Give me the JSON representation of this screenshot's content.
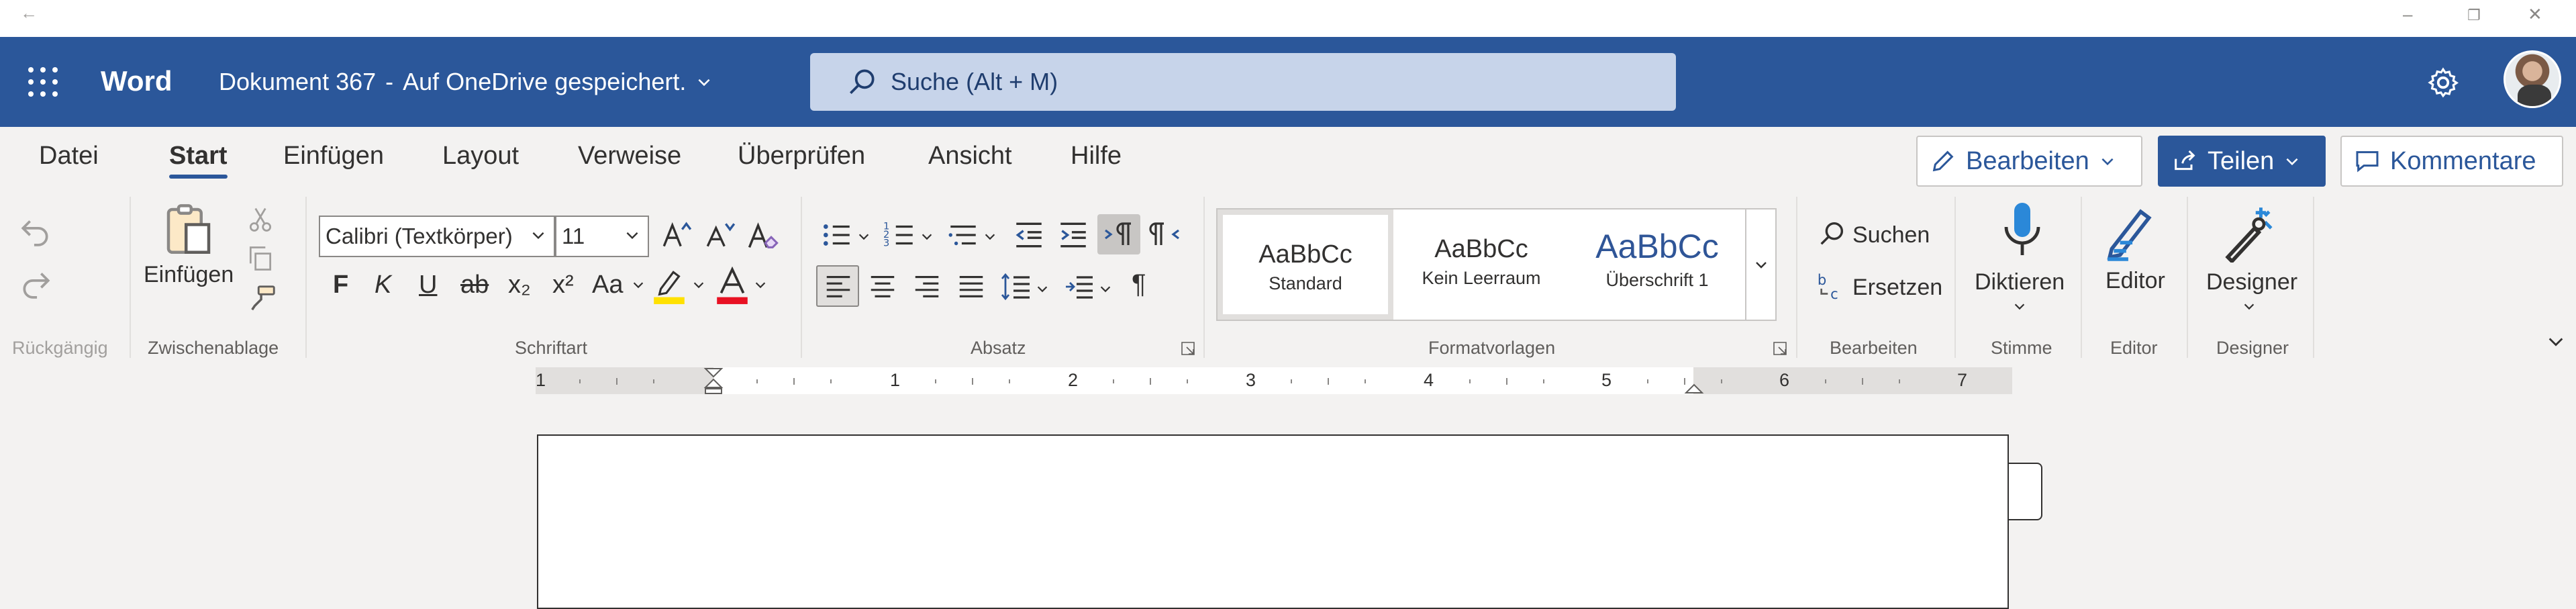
{
  "app": {
    "name": "Word",
    "document_title": "Dokument 367",
    "title_separator": "-",
    "save_status": "Auf OneDrive gespeichert.",
    "brand_color": "#2b579a"
  },
  "search": {
    "placeholder": "Suche (Alt + M)"
  },
  "window": {
    "back": "←",
    "minimize": "–",
    "restore": "❐",
    "close": "✕"
  },
  "tabs": [
    {
      "label": "Datei"
    },
    {
      "label": "Start"
    },
    {
      "label": "Einfügen"
    },
    {
      "label": "Layout"
    },
    {
      "label": "Verweise"
    },
    {
      "label": "Überprüfen"
    },
    {
      "label": "Ansicht"
    },
    {
      "label": "Hilfe"
    }
  ],
  "active_tab": "Start",
  "actions": {
    "edit": "Bearbeiten",
    "share": "Teilen",
    "comments": "Kommentare"
  },
  "ribbon": {
    "undo_group": {
      "label": "Rückgängig"
    },
    "clipboard": {
      "label": "Zwischenablage",
      "paste": "Einfügen"
    },
    "font": {
      "label": "Schriftart",
      "family": "Calibri (Textkörper)",
      "size": "11",
      "bold": "F",
      "italic": "K",
      "underline": "U",
      "strike": "ab",
      "subscript": "x₂",
      "superscript": "x²",
      "case": "Aa"
    },
    "paragraph": {
      "label": "Absatz",
      "pilcrow": "¶"
    },
    "styles": {
      "label": "Formatvorlagen",
      "items": [
        {
          "preview": "AaBbCc",
          "name": "Standard"
        },
        {
          "preview": "AaBbCc",
          "name": "Kein Leerraum"
        },
        {
          "preview": "AaBbCc",
          "name": "Überschrift 1"
        }
      ]
    },
    "editing": {
      "label": "Bearbeiten",
      "find": "Suchen",
      "replace": "Ersetzen"
    },
    "voice": {
      "label": "Stimme",
      "dictate": "Diktieren"
    },
    "editor": {
      "label": "Editor",
      "button": "Editor"
    },
    "designer": {
      "label": "Designer",
      "button": "Designer"
    }
  },
  "ruler": {
    "numbers": [
      "1",
      "1",
      "2",
      "3",
      "4",
      "5",
      "6",
      "7"
    ]
  }
}
